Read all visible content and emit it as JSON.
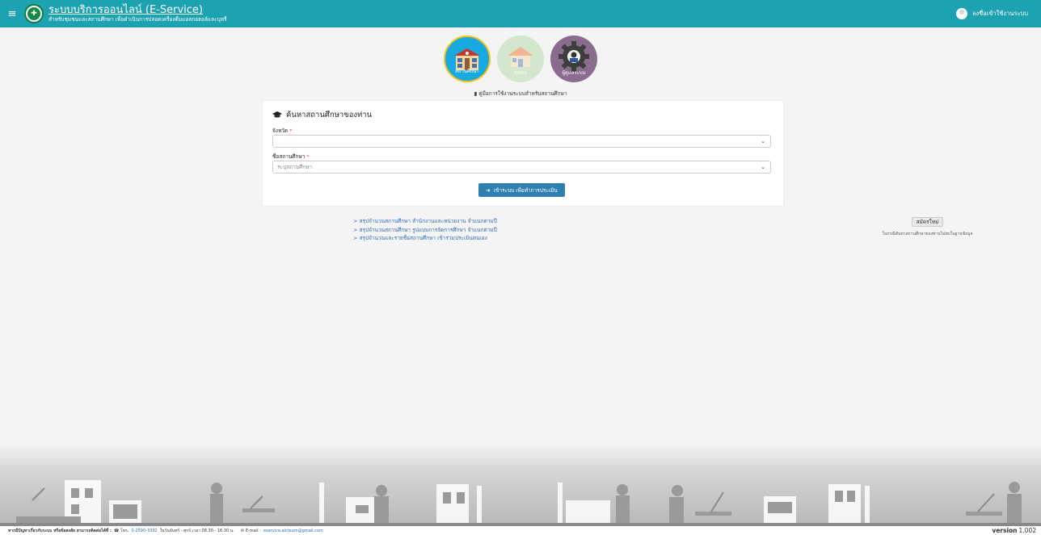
{
  "header": {
    "title": "ระบบบริการออนไลน์ (E-Service)",
    "subtitle": "สำหรับชุมชนและสถานศึกษา เพื่อดำเนินการปลอดเครื่องดื่มแอลกอฮอล์และบุหรี่",
    "login_label": "ลงชื่อเข้าใช้งานระบบ"
  },
  "roles": [
    {
      "label": "สถานศึกษา"
    },
    {
      "label": "ชุมชน"
    },
    {
      "label": "ผู้ดูแลระบบ"
    }
  ],
  "guide_link": "คู่มือการใช้งานระบบสำหรับสถานศึกษา",
  "search": {
    "title": "ค้นหาสถานศึกษาของท่าน",
    "province_label": "จังหวัด",
    "province_value": "",
    "school_label": "ชื่อสถานศึกษา",
    "school_placeholder": "ระบุสถานศึกษา",
    "required_mark": "*",
    "enter_button": "เข้าระบบ เพื่อทำการประเมิน"
  },
  "report_links": [
    "> สรุปจำนวนสถานศึกษา สำนักงานและหน่วยงาน จำแนกตามปี",
    "> สรุปจำนวนสถานศึกษา รูปแบบการจัดการศึกษา จำแนกตามปี",
    "> สรุปจำนวนและรายชื่อสถานศึกษา เข้าร่วมประเมินตนเอง"
  ],
  "register": {
    "button": "สมัครใหม่",
    "note": "ในกรณีค้นหาสถานศึกษาของท่านไม่พบในฐานข้อมูล"
  },
  "footer": {
    "problem_text": "หากมีปัญหาเกี่ยวกับระบบ หรือข้อสงสัย สามารถติดต่อได้ที่ :",
    "phone_prefix": "โทร.",
    "phone": "0-2590-3392",
    "hours": "ในวันจันทร์ - ศุกร์ เวลา 08.30 - 16.30 น.",
    "email_prefix": "E-mail :",
    "email": "eservice.alcteam@gmail.com",
    "version_label": "version",
    "version_number": "1.002"
  },
  "colors": {
    "header": "#1ca2b0",
    "button": "#2f7fb3",
    "link": "#2f6db5"
  }
}
